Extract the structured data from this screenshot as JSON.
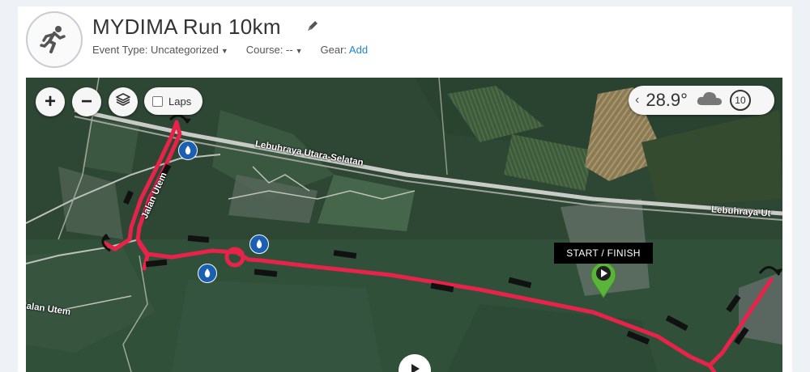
{
  "activity": {
    "title": "MYDIMA Run 10km",
    "icon": "runner-icon"
  },
  "meta": {
    "event_type_label": "Event Type: Uncategorized",
    "course_label": "Course: --",
    "gear_label": "Gear:",
    "gear_add": "Add"
  },
  "map": {
    "controls": {
      "zoom_in": "+",
      "zoom_out": "−",
      "layers_icon": "layers-icon",
      "laps_label": "Laps"
    },
    "weather": {
      "temperature": "28.9°",
      "condition_icon": "cloud-icon",
      "wind_speed": "10"
    },
    "start_finish_label": "START / FINISH",
    "road_labels": {
      "highway_1": "Lebuhraya Utara-Selatan",
      "highway_2": "Lebuhraya Ut",
      "jalan_1": "Jalan Utem",
      "jalan_2": "Jalan Utem"
    },
    "route_color": "#e8234a",
    "water_station_color": "#1a5fb4"
  }
}
